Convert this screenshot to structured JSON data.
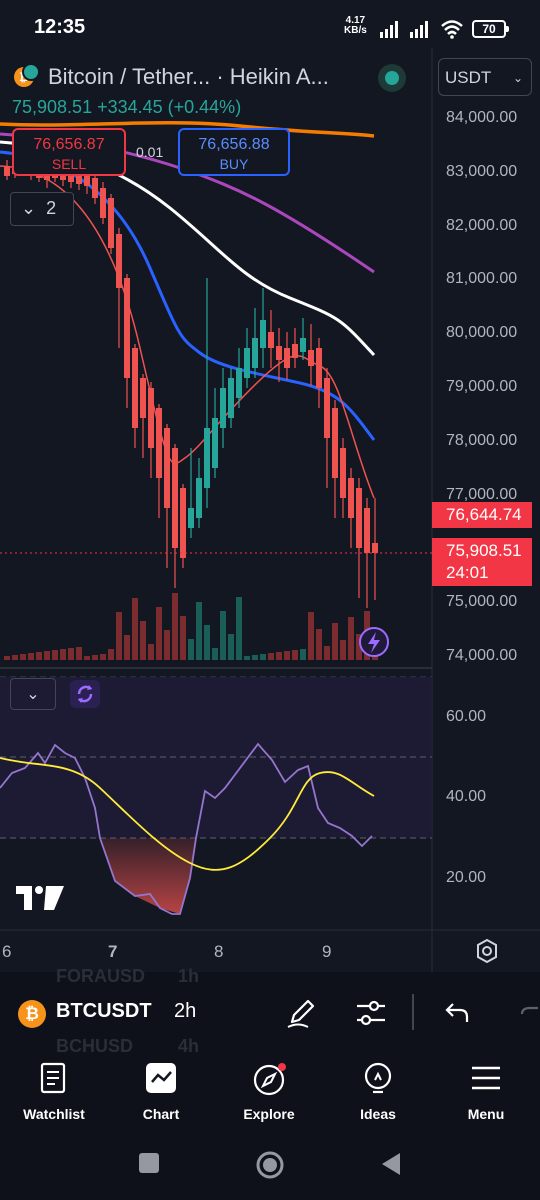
{
  "status_bar": {
    "time": "12:35",
    "speed_value": "4.17",
    "speed_unit": "KB/s",
    "battery": "70"
  },
  "header": {
    "title": "Bitcoin / Tether...  · Heikin A...",
    "price_line": "75,908.51 +334.45 (+0.44%)",
    "currency": "USDT",
    "spread": "0.01"
  },
  "trade": {
    "sell_price": "76,656.87",
    "sell_label": "SELL",
    "buy_price": "76,656.88",
    "buy_label": "BUY"
  },
  "indicators_toggle": {
    "count": "2"
  },
  "price_axis": [
    "84,000.00",
    "83,000.00",
    "82,000.00",
    "81,000.00",
    "80,000.00",
    "79,000.00",
    "78,000.00",
    "77,000.00",
    "75,000.00",
    "74,000.00"
  ],
  "price_tags": {
    "ma_price": "76,644.74",
    "last_price": "75,908.51",
    "countdown": "24:01"
  },
  "rsi_axis": [
    "60.00",
    "40.00",
    "20.00"
  ],
  "time_axis": [
    "6",
    "7",
    "8",
    "9"
  ],
  "toolbar": {
    "symbol": "BTCUSDT",
    "interval": "2h",
    "ghost_above_symbol": "FORAUSD",
    "ghost_above_interval": "1h",
    "ghost_below_symbol": "BCHUSD",
    "ghost_below_interval": "4h"
  },
  "nav": [
    {
      "label": "Watchlist",
      "icon": "watchlist-icon"
    },
    {
      "label": "Chart",
      "icon": "chart-icon"
    },
    {
      "label": "Explore",
      "icon": "compass-icon"
    },
    {
      "label": "Ideas",
      "icon": "lightbulb-icon"
    },
    {
      "label": "Menu",
      "icon": "menu-icon"
    }
  ],
  "colors": {
    "up": "#26a69a",
    "down": "#ef5350",
    "buy": "#2962ff",
    "sell": "#f23645",
    "background": "#131722"
  }
}
